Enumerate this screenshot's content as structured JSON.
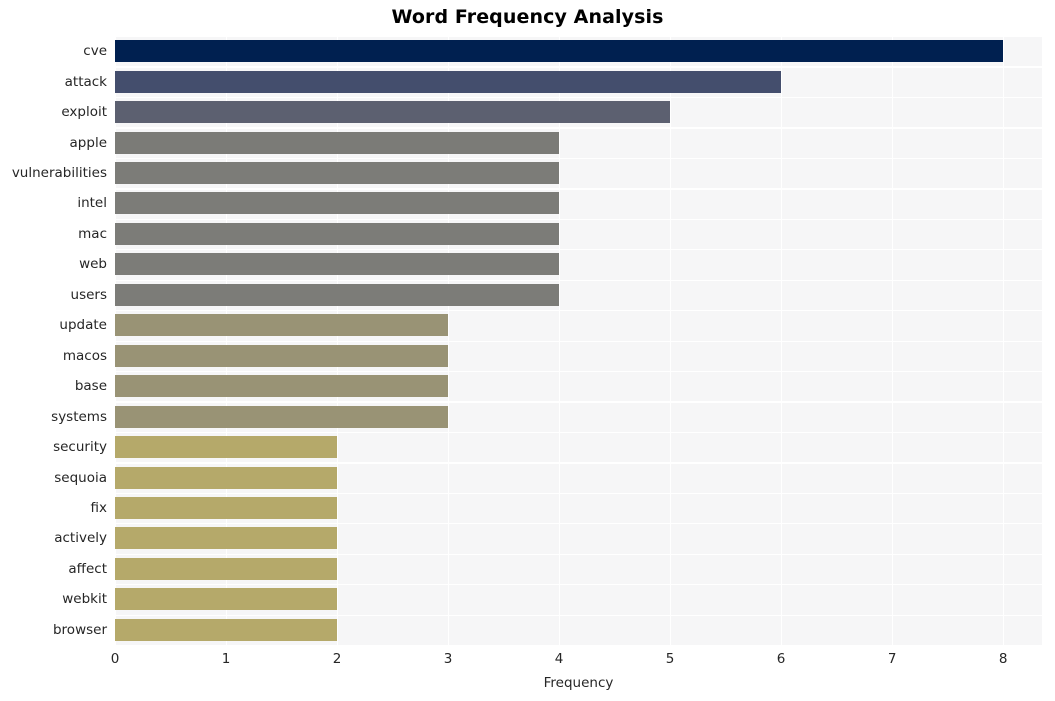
{
  "chart_data": {
    "type": "bar",
    "orientation": "horizontal",
    "title": "Word Frequency Analysis",
    "xlabel": "Frequency",
    "ylabel": "",
    "xlim": [
      0,
      8.35
    ],
    "ylim": [
      0,
      20
    ],
    "grid": true,
    "legend": null,
    "xticks": [
      0,
      1,
      2,
      3,
      4,
      5,
      6,
      7,
      8
    ],
    "xtick_labels": [
      "0",
      "1",
      "2",
      "3",
      "4",
      "5",
      "6",
      "7",
      "8"
    ],
    "categories": [
      "cve",
      "attack",
      "exploit",
      "apple",
      "vulnerabilities",
      "intel",
      "mac",
      "web",
      "users",
      "update",
      "macos",
      "base",
      "systems",
      "security",
      "sequoia",
      "fix",
      "actively",
      "affect",
      "webkit",
      "browser"
    ],
    "values": [
      8,
      6,
      5,
      4,
      4,
      4,
      4,
      4,
      4,
      3,
      3,
      3,
      3,
      2,
      2,
      2,
      2,
      2,
      2,
      2
    ],
    "bar_colors": [
      "#002050",
      "#444e6d",
      "#5c6070",
      "#7b7b77",
      "#7c7c78",
      "#7c7c78",
      "#7c7c78",
      "#7c7c78",
      "#7c7c78",
      "#999375",
      "#999375",
      "#999375",
      "#999375",
      "#b5a96a",
      "#b5a96a",
      "#b5a96a",
      "#b5a96a",
      "#b5a96a",
      "#b5a96a",
      "#b5a96a"
    ],
    "background_color": "#f6f6f7",
    "gridline_color": "#ffffff",
    "figure_background": "#ffffff"
  }
}
